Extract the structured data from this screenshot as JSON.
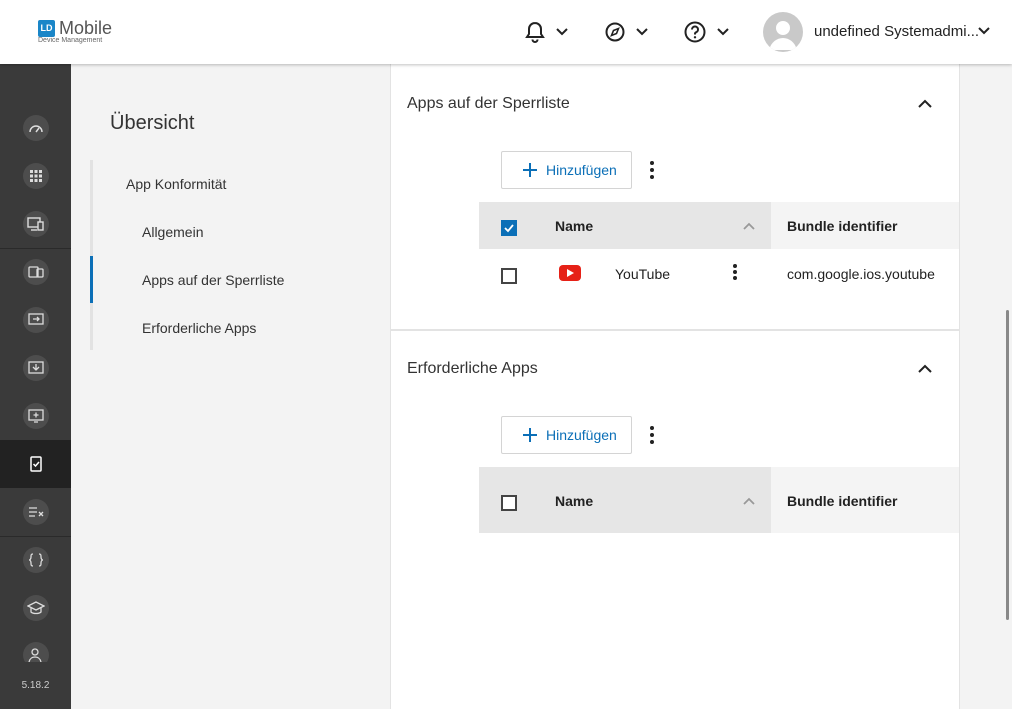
{
  "header": {
    "logo_mark": "LD",
    "logo_title": "Mobile",
    "logo_subtitle": "Device Management",
    "icons": {
      "notifications": "bell-icon",
      "compass": "compass-icon",
      "help": "help-icon",
      "chevron": "chevron-down-icon"
    },
    "user_name": "undefined Systemadmi..."
  },
  "rail": {
    "items": [
      {
        "icon": "dashboard-icon"
      },
      {
        "icon": "apps-grid-icon"
      },
      {
        "icon": "devices-icon"
      },
      {
        "icon": "device-group-icon"
      },
      {
        "icon": "deploy-icon"
      },
      {
        "icon": "download-icon"
      },
      {
        "icon": "monitor-add-icon"
      },
      {
        "icon": "compliance-icon",
        "active": true
      },
      {
        "icon": "list-check-icon"
      },
      {
        "icon": "code-braces-icon"
      },
      {
        "icon": "education-icon"
      },
      {
        "icon": "users-icon"
      }
    ],
    "version": "5.18.2"
  },
  "overview": {
    "title": "Übersicht",
    "items": [
      {
        "label": "App Konformität"
      },
      {
        "label": "Allgemein"
      },
      {
        "label": "Apps auf der Sperrliste",
        "active": true
      },
      {
        "label": "Erforderliche Apps"
      }
    ]
  },
  "blocklist": {
    "title": "Apps auf der Sperrliste",
    "add_label": "Hinzufügen",
    "columns": {
      "name": "Name",
      "bundle": "Bundle identifier"
    },
    "header_checked": true,
    "rows": [
      {
        "icon": "youtube-icon",
        "name": "YouTube",
        "bundle": "com.google.ios.youtube",
        "checked": false
      }
    ]
  },
  "required": {
    "title": "Erforderliche Apps",
    "add_label": "Hinzufügen",
    "columns": {
      "name": "Name",
      "bundle": "Bundle identifier"
    },
    "header_checked": false,
    "rows": []
  },
  "colors": {
    "accent": "#0b6fb7",
    "rail_bg": "#3a3a3a",
    "youtube_red": "#e62117"
  }
}
